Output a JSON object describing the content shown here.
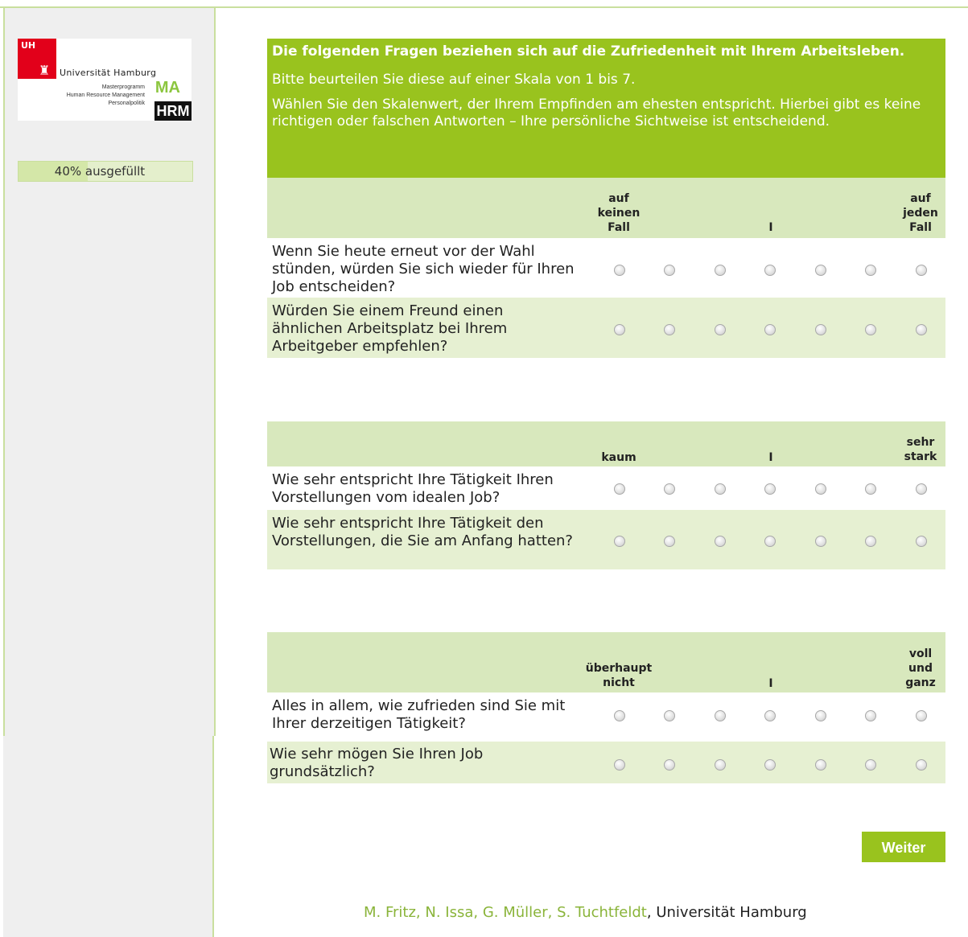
{
  "logo": {
    "badge": "UH",
    "university": "Universität Hamburg",
    "program_lines": [
      "Masterprogramm",
      "Human Resource Management",
      "Personalpolitik"
    ],
    "ma": "MA",
    "hrm": "HRM"
  },
  "progress": {
    "percent_text": "40%",
    "label": "ausgefüllt",
    "value": 0.4
  },
  "header": {
    "title": "Die folgenden Fragen beziehen sich auf die Zufriedenheit mit Ihrem Arbeitsleben.",
    "p1": "Bitte beurteilen Sie diese auf einer Skala von 1 bis 7.",
    "p2": "Wählen Sie den Skalenwert, der Ihrem Empfinden am ehesten entspricht. Hierbei gibt es keine richtigen oder falschen Antworten – Ihre persönliche Sichtweise ist entscheidend."
  },
  "blocks": [
    {
      "scale_low": "auf keinen Fall",
      "scale_mid": "I",
      "scale_high": "auf jeden Fall",
      "questions": [
        "Wenn Sie heute erneut vor der Wahl stünden, würden Sie sich wieder für Ihren Job entscheiden?",
        "Würden Sie einem Freund einen ähnlichen Arbeitsplatz bei Ihrem Arbeitgeber empfehlen?"
      ]
    },
    {
      "scale_low": "kaum",
      "scale_mid": "I",
      "scale_high": "sehr stark",
      "questions": [
        "Wie sehr entspricht Ihre Tätigkeit Ihren Vorstellungen vom idealen Job?",
        "Wie sehr entspricht Ihre Tätigkeit den Vorstellungen, die Sie am Anfang hatten?"
      ]
    },
    {
      "scale_low": "überhaupt nicht",
      "scale_mid": "I",
      "scale_high": "voll und ganz",
      "questions": [
        "Alles in allem, wie zufrieden sind Sie mit Ihrer derzeitigen Tätigkeit?",
        "Wie sehr mögen Sie Ihren Job grundsätzlich?"
      ]
    }
  ],
  "buttons": {
    "next": "Weiter"
  },
  "footer": {
    "authors": "M. Fritz, N. Issa, G. Müller, S. Tuchtfeldt",
    "separator": ", ",
    "institution": "Universität Hamburg"
  },
  "colors": {
    "brand_green": "#99c31e",
    "band": "#d8e8bd",
    "row_alt": "#e6f0d2",
    "sidebar": "#efefef"
  }
}
